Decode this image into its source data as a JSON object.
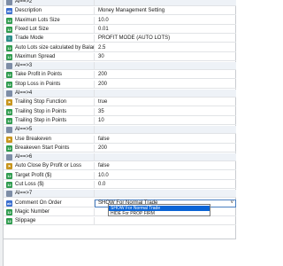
{
  "rows": [
    {
      "name": "Al==>2",
      "value": "",
      "kind": "group",
      "icon": "group-icon"
    },
    {
      "name": "Description",
      "value": "Money Management Setting",
      "kind": "param",
      "icon": "ab-icon"
    },
    {
      "name": "Maximun Lots Size",
      "value": "10.0",
      "kind": "param",
      "icon": "number-icon"
    },
    {
      "name": "Fixed Lot Size",
      "value": "0.01",
      "kind": "param",
      "icon": "number-icon"
    },
    {
      "name": "Trade Mode",
      "value": "PROFIT MODE (AUTO LOTS)",
      "kind": "param",
      "icon": "enum-icon"
    },
    {
      "name": "Auto Lots size calculated by Balance(%)",
      "value": "2.5",
      "kind": "param",
      "icon": "number-icon"
    },
    {
      "name": "Maximun Spread",
      "value": "30",
      "kind": "param",
      "icon": "number-icon"
    },
    {
      "name": "Al==>3",
      "value": "",
      "kind": "group",
      "icon": "group-icon"
    },
    {
      "name": "Take Profit in Points",
      "value": "200",
      "kind": "param",
      "icon": "number-icon"
    },
    {
      "name": "Stop Loss in Points",
      "value": "200",
      "kind": "param",
      "icon": "number-icon"
    },
    {
      "name": "Al==>4",
      "value": "",
      "kind": "group",
      "icon": "group-icon"
    },
    {
      "name": "Trailing Stop Function",
      "value": "true",
      "kind": "param",
      "icon": "flag-icon"
    },
    {
      "name": "Trailing Stop in Points",
      "value": "35",
      "kind": "param",
      "icon": "number-icon"
    },
    {
      "name": "Trailing Step in Points",
      "value": "10",
      "kind": "param",
      "icon": "number-icon"
    },
    {
      "name": "Al==>5",
      "value": "",
      "kind": "group",
      "icon": "group-icon"
    },
    {
      "name": "Use Breakeven",
      "value": "false",
      "kind": "param",
      "icon": "flag-icon"
    },
    {
      "name": "Breakeven Start Points",
      "value": "200",
      "kind": "param",
      "icon": "number-icon"
    },
    {
      "name": "Al==>6",
      "value": "",
      "kind": "group",
      "icon": "group-icon"
    },
    {
      "name": "Auto Close By Profit or Loss",
      "value": "false",
      "kind": "param",
      "icon": "flag-icon"
    },
    {
      "name": "Target Profit ($)",
      "value": "10.0",
      "kind": "param",
      "icon": "number-icon"
    },
    {
      "name": "Cut Loss ($)",
      "value": "0.0",
      "kind": "param",
      "icon": "number-icon"
    },
    {
      "name": "Al==>7",
      "value": "",
      "kind": "group",
      "icon": "group-icon"
    },
    {
      "name": "Comment On Order",
      "value": "SHOW For Normal Trade",
      "kind": "dropdown",
      "icon": "ab-icon"
    },
    {
      "name": "Magic Number",
      "value": "",
      "kind": "param",
      "icon": "number-icon"
    },
    {
      "name": "Slippage",
      "value": "",
      "kind": "param",
      "icon": "number-icon"
    }
  ],
  "dropdown": {
    "options": [
      "SHOW For Normal Trade",
      "HIDE For PROP FIRM"
    ],
    "selected_index": 0,
    "arrow": "chevron-down-icon"
  },
  "colors": {
    "selection": "#0a64d6",
    "group_row": "#eef2f7"
  }
}
